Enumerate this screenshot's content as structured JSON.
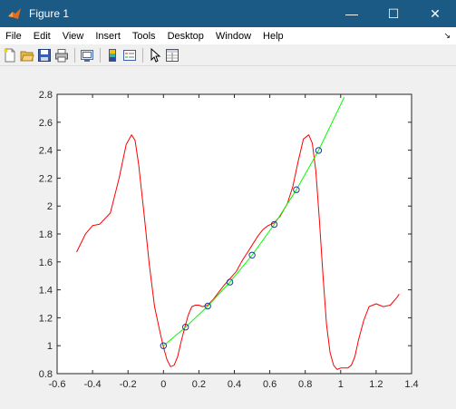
{
  "window": {
    "title": "Figure 1",
    "minimize_glyph": "—",
    "maximize_glyph": "☐",
    "close_glyph": "✕",
    "accent": "#1c5a86"
  },
  "menu": {
    "items": [
      "File",
      "Edit",
      "View",
      "Insert",
      "Tools",
      "Desktop",
      "Window",
      "Help"
    ],
    "dock_arrow": "↘"
  },
  "toolbar": {
    "icons": [
      "new-figure-icon",
      "open-file-icon",
      "save-icon",
      "print-icon",
      "link-plot-icon",
      "insert-colorbar-icon",
      "insert-legend-icon",
      "pointer-icon",
      "property-inspector-icon"
    ]
  },
  "chart_data": {
    "type": "line",
    "xlim": [
      -0.6,
      1.4
    ],
    "ylim": [
      0.8,
      2.8
    ],
    "xticks": [
      -0.6,
      -0.4,
      -0.2,
      0,
      0.2,
      0.4,
      0.6,
      0.8,
      1,
      1.2,
      1.4
    ],
    "xtick_labels": [
      "-0.6",
      "-0.4",
      "-0.2",
      "0",
      "0.2",
      "0.4",
      "0.6",
      "0.8",
      "1",
      "1.2",
      "1.4"
    ],
    "yticks": [
      0.8,
      1,
      1.2,
      1.4,
      1.6,
      1.8,
      2,
      2.2,
      2.4,
      2.6,
      2.8
    ],
    "ytick_labels": [
      "0.8",
      "1",
      "1.2",
      "1.4",
      "1.6",
      "1.8",
      "2",
      "2.2",
      "2.4",
      "2.6",
      "2.8"
    ],
    "grid": false,
    "legend": "none",
    "series": [
      {
        "color": "#ff0000",
        "style": "line",
        "x": [
          -0.49,
          -0.44,
          -0.4,
          -0.36,
          -0.3,
          -0.25,
          -0.21,
          -0.18,
          -0.16,
          -0.14,
          -0.11,
          -0.08,
          -0.05,
          -0.02,
          0.0,
          0.02,
          0.04,
          0.06,
          0.08,
          0.1,
          0.12,
          0.14,
          0.16,
          0.18,
          0.2,
          0.22,
          0.25,
          0.28,
          0.31,
          0.34,
          0.375,
          0.41,
          0.44,
          0.47,
          0.5,
          0.53,
          0.56,
          0.59,
          0.625,
          0.66,
          0.7,
          0.73,
          0.76,
          0.79,
          0.82,
          0.84,
          0.86,
          0.88,
          0.9,
          0.92,
          0.94,
          0.96,
          0.98,
          1.0,
          1.02,
          1.04,
          1.06,
          1.08,
          1.1,
          1.13,
          1.16,
          1.2,
          1.24,
          1.28,
          1.32,
          1.33
        ],
        "y": [
          1.67,
          1.8,
          1.86,
          1.87,
          1.95,
          2.2,
          2.44,
          2.51,
          2.47,
          2.3,
          1.95,
          1.58,
          1.28,
          1.1,
          0.99,
          0.9,
          0.85,
          0.86,
          0.92,
          1.03,
          1.13,
          1.22,
          1.28,
          1.29,
          1.29,
          1.28,
          1.29,
          1.33,
          1.38,
          1.43,
          1.48,
          1.53,
          1.6,
          1.66,
          1.72,
          1.78,
          1.83,
          1.86,
          1.88,
          1.93,
          2.02,
          2.14,
          2.32,
          2.48,
          2.51,
          2.45,
          2.25,
          1.9,
          1.5,
          1.15,
          0.95,
          0.86,
          0.83,
          0.84,
          0.84,
          0.84,
          0.86,
          0.92,
          1.04,
          1.18,
          1.28,
          1.3,
          1.28,
          1.29,
          1.35,
          1.37
        ]
      },
      {
        "color": "#00ff00",
        "style": "line",
        "x": [
          0,
          0.125,
          0.25,
          0.375,
          0.5,
          0.625,
          0.75,
          0.875,
          1.02
        ],
        "y": [
          1.0,
          1.133,
          1.284,
          1.455,
          1.649,
          1.868,
          2.117,
          2.398,
          2.78
        ]
      },
      {
        "color": "#1f3a93",
        "style": "marker-circle",
        "x": [
          0,
          0.125,
          0.25,
          0.375,
          0.5,
          0.625,
          0.75,
          0.875
        ],
        "y": [
          1.0,
          1.133,
          1.284,
          1.455,
          1.649,
          1.868,
          2.117,
          2.398
        ]
      }
    ]
  }
}
